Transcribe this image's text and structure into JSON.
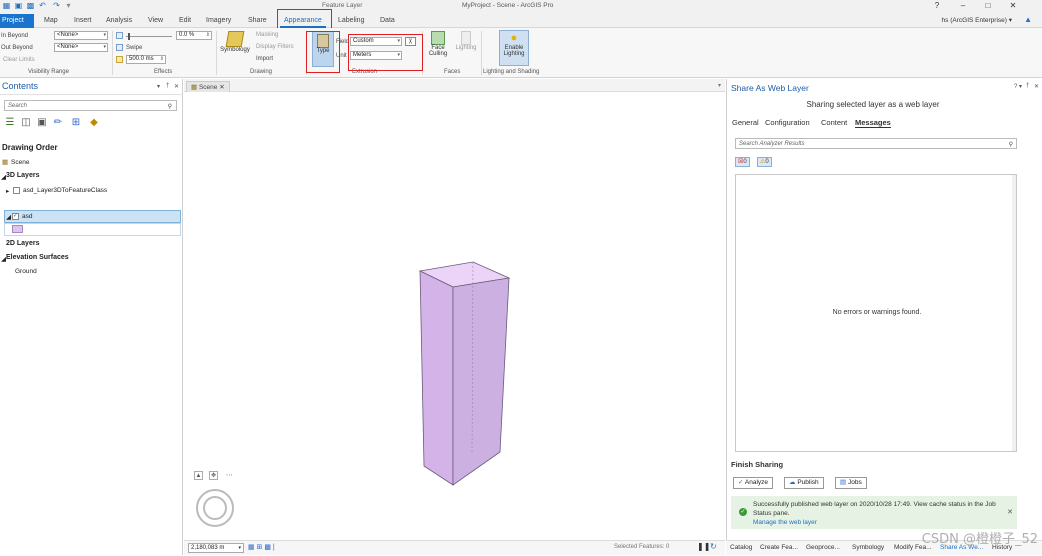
{
  "titlebar": {
    "context_title": "Feature Layer",
    "app_title": "MyProject - Scene - ArcGIS Pro",
    "window_controls": [
      "?",
      "–",
      "□",
      "✕"
    ]
  },
  "tabs": [
    "Project",
    "Map",
    "Insert",
    "Analysis",
    "View",
    "Edit",
    "Imagery",
    "Share",
    "Appearance",
    "Labeling",
    "Data"
  ],
  "active_tab": "Appearance",
  "user": {
    "label": "hs (ArcGIS Enterprise) ▾"
  },
  "ribbon": {
    "visibility_range": {
      "in_beyond_label": "In Beyond",
      "out_beyond_label": "Out Beyond",
      "clear_limits_label": "Clear Limits",
      "in_beyond_value": "<None>",
      "out_beyond_value": "<None>",
      "group_label": "Visibility Range"
    },
    "effects": {
      "transparency_value": "0.0 %",
      "swipe_label": "Swipe",
      "flicker_value": "500.0 ms",
      "group_label": "Effects"
    },
    "drawing": {
      "symbology_label": "Symbology",
      "masking_label": "Masking",
      "display_filters_label": "Display Filters",
      "import_label": "Import",
      "group_label": "Drawing"
    },
    "extrusion": {
      "type_label": "Type",
      "field_label": "Field",
      "field_value": "Custom",
      "unit_label": "Unit",
      "unit_value": "Meters",
      "group_label": "Extrusion"
    },
    "faces": {
      "face_culling_label": "Face Culling",
      "lighting_label": "Lighting",
      "group_label": "Faces"
    },
    "lighting_shading": {
      "enable_lighting_label": "Enable Lighting",
      "group_label": "Lighting and Shading"
    }
  },
  "contents": {
    "title": "Contents",
    "search_placeholder": "Search",
    "drawing_order_label": "Drawing Order",
    "scene_label": "Scene",
    "layers_3d_label": "3D Layers",
    "layer_3d_item": "asd_Layer3DToFeatureClass",
    "selected_layer": "asd",
    "layers_2d_label": "2D Layers",
    "elevation_label": "Elevation Surfaces",
    "ground_label": "Ground"
  },
  "scene": {
    "tab_label": "Scene",
    "scale_value": "2,180,083 m",
    "selected_features": "Selected Features: 0",
    "extrusion_color": "#d3b3e8"
  },
  "share_pane": {
    "title": "Share As Web Layer",
    "subtitle": "Sharing selected layer as a web layer",
    "tabs": [
      "General",
      "Configuration",
      "Content",
      "Messages"
    ],
    "active_tab": "Messages",
    "search_placeholder": "Search Analyzer Results",
    "errors_count": "0",
    "warnings_count": "0",
    "no_messages": "No errors or warnings found.",
    "finish_title": "Finish Sharing",
    "buttons": [
      "Analyze",
      "Publish",
      "Jobs"
    ],
    "success_text": "Successfully published web layer on 2020/10/28 17:49. View cache status in the Job Status pane.",
    "success_link": "Manage the web layer"
  },
  "bottom_tabs": [
    "Catalog",
    "Create Fea...",
    "Geoproce...",
    "Symbology",
    "Modify Fea...",
    "Share As We...",
    "History"
  ],
  "watermark": "CSDN @橙橙子_52"
}
